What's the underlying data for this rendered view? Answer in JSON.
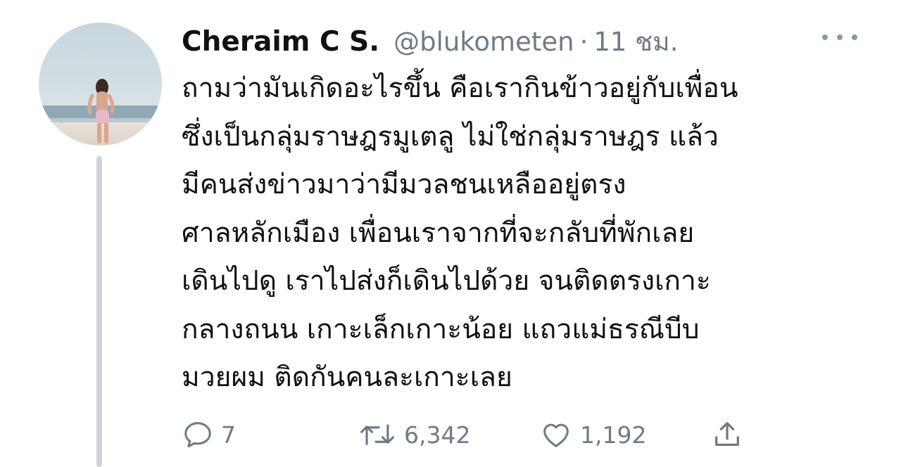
{
  "tweet": {
    "display_name": "Cheraim C S.",
    "handle": "@blukometen",
    "separator": "·",
    "time": "11 ชม.",
    "body_lines": [
      "ถามว่ามันเกิดอะไรขึ้น คือเรากินข้าวอยู่กับเพื่อน",
      "ซึ่งเป็นกลุ่มราษฎรมูเตลู ไม่ใช่กลุ่มราษฎร แล้ว",
      "มีคนส่งข่าวมาว่ามีมวลชนเหลืออยู่ตรง",
      "ศาลหลักเมือง เพื่อนเราจากที่จะกลับที่พักเลย",
      "เดินไปดู เราไปส่งก็เดินไปด้วย จนติดตรงเกาะ",
      "กลางถนน เกาะเล็กเกาะน้อย แถวแม่ธรณีบีบ",
      "มวยผม ติดกันคนละเกาะเลย"
    ],
    "actions": {
      "reply_count": "7",
      "retweet_count": "6,342",
      "like_count": "1,192"
    }
  },
  "icons": {
    "reply": "reply-icon",
    "retweet": "retweet-icon",
    "like": "heart-icon",
    "share": "share-icon",
    "more": "more-icon"
  },
  "colors": {
    "text": "#111111",
    "muted": "#6e7b86",
    "thread_line": "#cdd3d9"
  }
}
